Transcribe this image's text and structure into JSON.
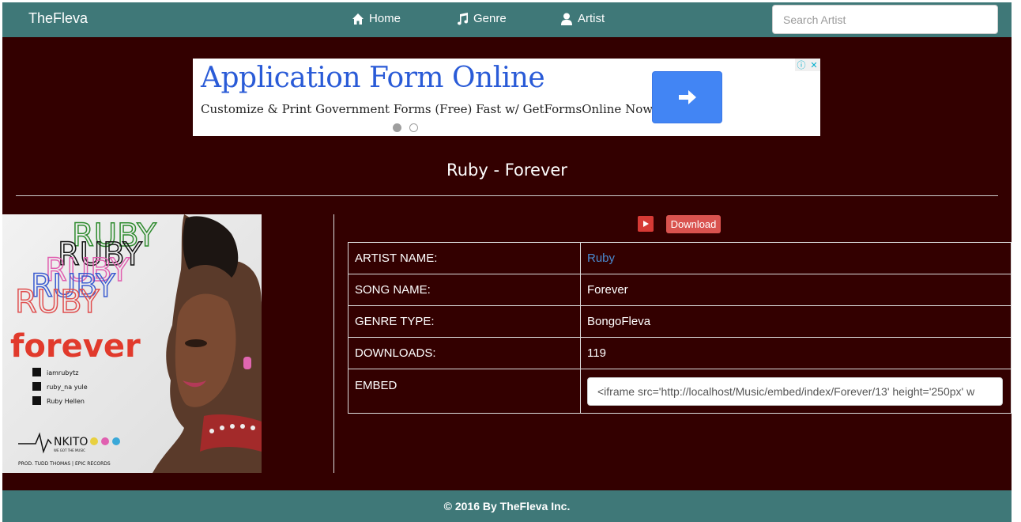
{
  "nav": {
    "brand": "TheFleva",
    "items": [
      {
        "label": "Home",
        "icon": "home-icon"
      },
      {
        "label": "Genre",
        "icon": "music-note-icon"
      },
      {
        "label": "Artist",
        "icon": "user-icon"
      }
    ],
    "search_placeholder": "Search Artist"
  },
  "ad": {
    "title": "Application Form Online",
    "subtitle": "Customize & Print Government Forms (Free) Fast w/ GetFormsOnline Now!",
    "button_icon": "arrow-right-icon",
    "info_icon": "info-icon",
    "close_icon": "close-icon"
  },
  "song": {
    "title": "Ruby - Forever",
    "download_label": "Download"
  },
  "cover": {
    "artist_lines": [
      "RUBY",
      "RUBY",
      "RUBY",
      "RUBY",
      "RUBY"
    ],
    "song_word": "forever",
    "social": [
      "iamrubytz",
      "ruby_na yule",
      "Ruby Hellen"
    ],
    "label": "NKITO",
    "tagline": "WE GOT THE MUSIC",
    "credits": "PROD. TUDD THOMAS | EPIC RECORDS"
  },
  "table": {
    "rows": [
      {
        "key": "ARTIST NAME:",
        "value": "Ruby"
      },
      {
        "key": "SONG NAME:",
        "value": "Forever"
      },
      {
        "key": "GENRE TYPE:",
        "value": "BongoFleva"
      },
      {
        "key": "DOWNLOADS:",
        "value": "119"
      }
    ],
    "embed_key": "EMBED",
    "embed_value": "<iframe src='http://localhost/Music/embed/index/Forever/13' height='250px' w"
  },
  "footer": {
    "text": "©  2016 By TheFleva Inc."
  },
  "colors": {
    "nav_bg": "#3f7878",
    "page_bg": "#330000",
    "download_red": "#d9534f",
    "link_blue": "#4a8ad0"
  }
}
